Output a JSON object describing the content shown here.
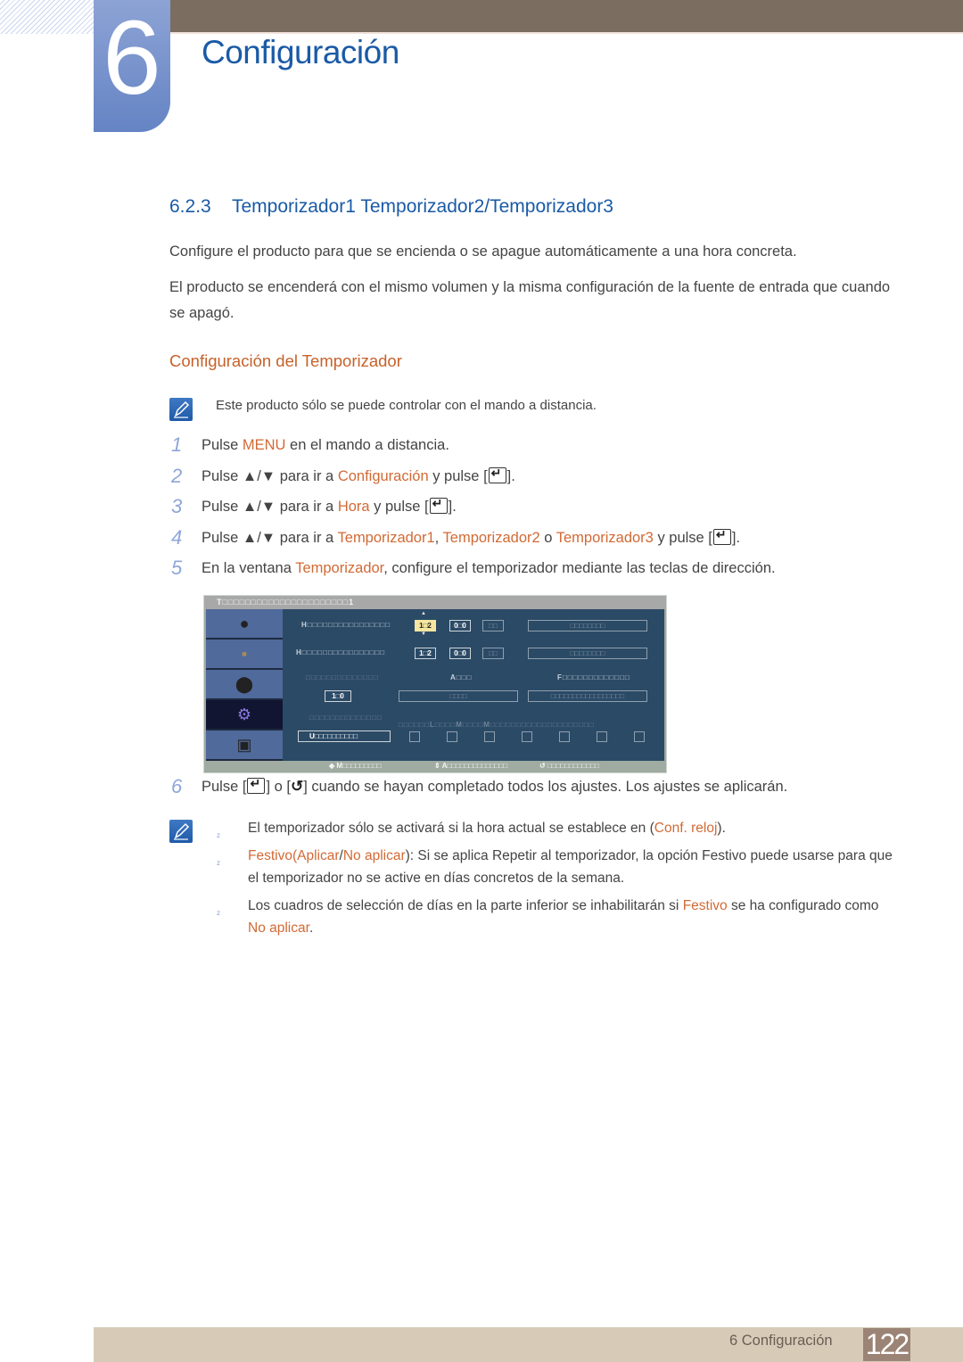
{
  "header": {
    "chapter_number": "6",
    "chapter_title": "Configuración"
  },
  "section": {
    "number": "6.2.3",
    "title": "Temporizador1 Temporizador2/Temporizador3",
    "intro_1": "Configure el producto para que se encienda o se apague automáticamente a una hora concreta.",
    "intro_2": "El producto se encenderá con el mismo volumen y la misma configuración de la fuente de entrada que cuando se apagó.",
    "subheading": "Configuración del Temporizador",
    "note": "Este producto sólo se puede controlar con el mando a distancia."
  },
  "steps": [
    {
      "num": "1",
      "pre": "Pulse ",
      "k1": "MENU",
      "post": " en el mando a distancia."
    },
    {
      "num": "2",
      "pre": "Pulse ▲/▼ para ir a ",
      "k1": "Configuración",
      "post": " y pulse ["
    },
    {
      "num": "3",
      "pre": "Pulse ▲/▼ para ir a ",
      "k1": "Hora",
      "post": " y pulse ["
    },
    {
      "num": "4",
      "pre": "Pulse ▲/▼ para ir a ",
      "k1": "Temporizador1",
      "sep1": ", ",
      "k2": "Temporizador2",
      "sep2": " o ",
      "k3": "Temporizador3",
      "post": " y pulse ["
    },
    {
      "num": "5",
      "pre": "En la ventana ",
      "k1": "Temporizador",
      "post": ", configure el temporizador mediante las teclas de dirección."
    },
    {
      "num": "6",
      "pre": "Pulse [",
      "mid": "] o [",
      "post": "] cuando se hayan completado todos los ajustes. Los ajustes se aplicarán."
    }
  ],
  "step_close": "].",
  "osd": {
    "title": "T□□□□□□□□□□□□□□□□□□□□□□1",
    "row1_label": "H□□□□□□□□□□□□□□□□",
    "row1_hour": "1□2",
    "row1_min": "0□0",
    "row1_ampm": "□□",
    "row1_wide": "□□□□□□□□",
    "row2_label": "H□□□□□□□□□□□□□□□□",
    "row2_hour": "1□2",
    "row2_min": "0□0",
    "row2_ampm": "□□",
    "row2_wide": "□□□□□□□□",
    "row3_label_a": "□□□□□□□□□□□□□□",
    "row3_label_b": "A□□□",
    "row3_label_c": "F□□□□□□□□□□□□□",
    "row4_vol": "1□0",
    "row4_src": "□□□□",
    "row4_holiday": "□□□□□□□□□□□□□□□□□",
    "row5_label": "□□□□□□□□□□□□□□",
    "days_label": "□□□□□□L□□□□M□□□□M□□□□□□□□□□□□□□□□□□□□",
    "repeat_value": "U□□□□□□□□□□",
    "day_checks": 7,
    "footer_move": "◆ M□□□□□□□□□",
    "footer_adjust": "⇕ A□□□□□□□□□□□□□□",
    "footer_return": "↺ □□□□□□□□□□□□",
    "side_icons": [
      "picture-icon",
      "sound-icon",
      "speaker-icon",
      "setup-gear-icon",
      "input-icon"
    ]
  },
  "notes": {
    "n1_pre": "El temporizador sólo se activará si la hora actual se establece en (",
    "n1_k": "Conf. reloj",
    "n1_post": ").",
    "n2_k1": "Festivo",
    "n2_p1": "(",
    "n2_k2": "Aplicar",
    "n2_p2": "/",
    "n2_k3": "No aplicar",
    "n2_post": "): Si se aplica Repetir al temporizador, la opción Festivo puede usarse para que el temporizador no se active en días concretos de la semana.",
    "n3_pre": "Los cuadros de selección de días en la parte inferior se inhabilitarán si ",
    "n3_k1": "Festivo",
    "n3_mid": " se ha configurado como ",
    "n3_k2": "No aplicar",
    "n3_post": ".",
    "bullet": "z"
  },
  "footer": {
    "label": "6 Configuración",
    "page": "122"
  }
}
